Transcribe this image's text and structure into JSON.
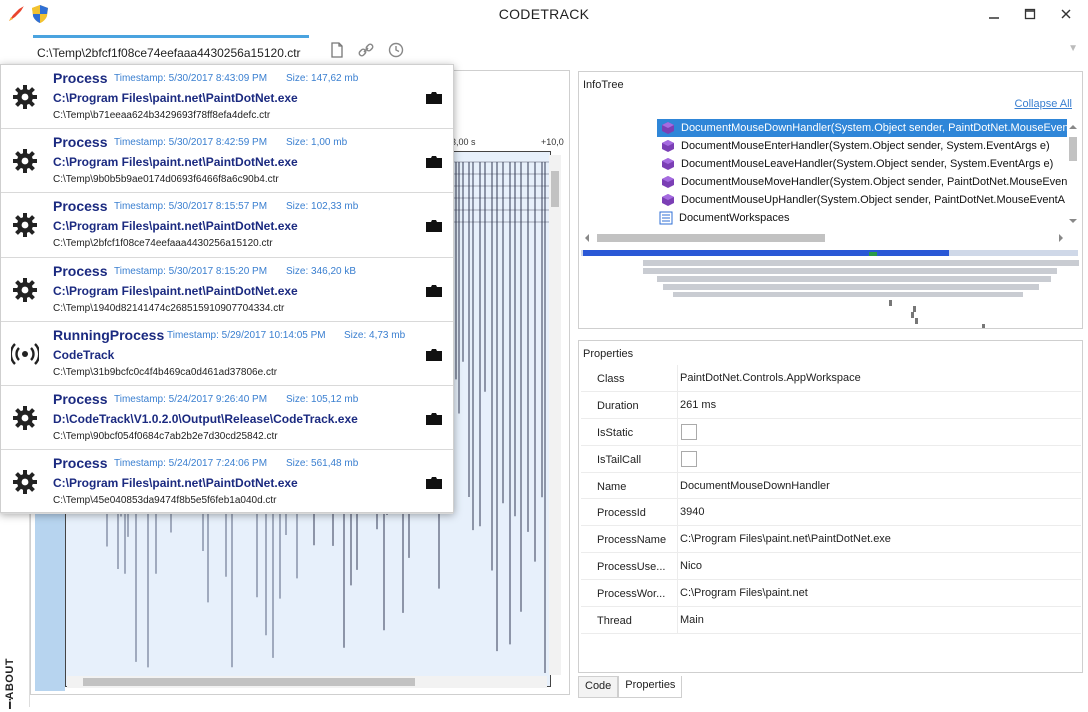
{
  "window": {
    "title": "CODETRACK",
    "controls": [
      "minimize-icon",
      "maximize-icon",
      "close-icon"
    ]
  },
  "tabs": {
    "active_file": "C:\\Temp\\2bfcf1f08ce74eefaaa4430256a15120.ctr",
    "tools": [
      "document-icon",
      "link-icon",
      "clock-icon"
    ]
  },
  "sidebar": {
    "about_label": "ABOUT",
    "info_glyph": "i"
  },
  "timeline": {
    "label_left": "3,00 s",
    "label_right": "+10,0"
  },
  "history": {
    "entries": [
      {
        "kind": "Process",
        "timestamp": "Timestamp: 5/30/2017 8:43:09 PM",
        "size": "Size: 147,62 mb",
        "path": "C:\\Program Files\\paint.net\\PaintDotNet.exe",
        "file": "C:\\Temp\\b71eeaa624b3429693f78ff8efa4defc.ctr",
        "icon": "gear-icon"
      },
      {
        "kind": "Process",
        "timestamp": "Timestamp: 5/30/2017 8:42:59 PM",
        "size": "Size: 1,00 mb",
        "path": "C:\\Program Files\\paint.net\\PaintDotNet.exe",
        "file": "C:\\Temp\\9b0b5b9ae0174d0693f6466f8a6c90b4.ctr",
        "icon": "gear-icon"
      },
      {
        "kind": "Process",
        "timestamp": "Timestamp: 5/30/2017 8:15:57 PM",
        "size": "Size: 102,33 mb",
        "path": "C:\\Program Files\\paint.net\\PaintDotNet.exe",
        "file": "C:\\Temp\\2bfcf1f08ce74eefaaa4430256a15120.ctr",
        "icon": "gear-icon"
      },
      {
        "kind": "Process",
        "timestamp": "Timestamp: 5/30/2017 8:15:20 PM",
        "size": "Size: 346,20 kB",
        "path": "C:\\Program Files\\paint.net\\PaintDotNet.exe",
        "file": "C:\\Temp\\1940d82141474c268515910907704334.ctr",
        "icon": "gear-icon"
      },
      {
        "kind": "RunningProcess",
        "timestamp": "Timestamp: 5/29/2017 10:14:05 PM",
        "size": "Size: 4,73 mb",
        "path": "CodeTrack",
        "file": "C:\\Temp\\31b9bcfc0c4f4b469ca0d461ad37806e.ctr",
        "icon": "broadcast-icon"
      },
      {
        "kind": "Process",
        "timestamp": "Timestamp: 5/24/2017 9:26:40 PM",
        "size": "Size: 105,12 mb",
        "path": "D:\\CodeTrack\\V1.0.2.0\\Output\\Release\\CodeTrack.exe",
        "file": "C:\\Temp\\90bcf054f0684c7ab2b2e7d30cd25842.ctr",
        "icon": "gear-icon"
      },
      {
        "kind": "Process",
        "timestamp": "Timestamp: 5/24/2017 7:24:06 PM",
        "size": "Size: 561,48 mb",
        "path": "C:\\Program Files\\paint.net\\PaintDotNet.exe",
        "file": "C:\\Temp\\45e040853da9474f8b5e5f6feb1a040d.ctr",
        "icon": "gear-icon"
      }
    ]
  },
  "infotree": {
    "title": "InfoTree",
    "collapse_all": "Collapse All",
    "items": [
      "DocumentMouseDownHandler(System.Object sender, PaintDotNet.MouseEvent",
      "DocumentMouseEnterHandler(System.Object sender, System.EventArgs e)",
      "DocumentMouseLeaveHandler(System.Object sender, System.EventArgs e)",
      "DocumentMouseMoveHandler(System.Object sender, PaintDotNet.MouseEven",
      "DocumentMouseUpHandler(System.Object sender, PaintDotNet.MouseEventA"
    ],
    "workspace_item": "DocumentWorkspaces"
  },
  "properties": {
    "title": "Properties",
    "rows": [
      {
        "key": "Class",
        "value": "PaintDotNet.Controls.AppWorkspace"
      },
      {
        "key": "Duration",
        "value": "261 ms"
      },
      {
        "key": "IsStatic",
        "value": ""
      },
      {
        "key": "IsTailCall",
        "value": ""
      },
      {
        "key": "Name",
        "value": "DocumentMouseDownHandler"
      },
      {
        "key": "ProcessId",
        "value": "3940"
      },
      {
        "key": "ProcessName",
        "value": "C:\\Program Files\\paint.net\\PaintDotNet.exe"
      },
      {
        "key": "ProcessUse...",
        "value": "Nico"
      },
      {
        "key": "ProcessWor...",
        "value": "C:\\Program Files\\paint.net"
      },
      {
        "key": "Thread",
        "value": "Main"
      }
    ]
  },
  "bottom_tabs": {
    "code": "Code",
    "properties": "Properties"
  },
  "colors": {
    "accent": "#2f86d8",
    "link": "#3a7fd0",
    "title_text": "#1b2a80",
    "cube": "#7b3fb5"
  }
}
